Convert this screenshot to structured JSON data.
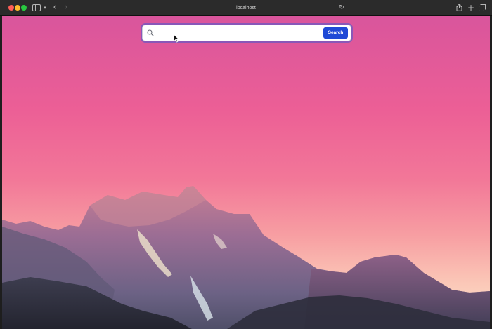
{
  "browser": {
    "address": "localhost",
    "icons": {
      "sidebar": "sidebar-icon",
      "back": "chevron-left-icon",
      "forward": "chevron-right-icon",
      "reload": "reload-icon",
      "share": "share-icon",
      "new_tab": "plus-icon",
      "tab_overview": "tab-overview-icon"
    },
    "traffic_lights": {
      "close": "#ff5f57",
      "minimize": "#febc2e",
      "maximize": "#28c840"
    }
  },
  "search": {
    "value": "",
    "placeholder": "",
    "button_label": "Search",
    "button_color": "#1f49d6",
    "icon": "search-icon"
  },
  "background": {
    "description_colors": [
      "#d9559c",
      "#f27798",
      "#fde6d2"
    ]
  }
}
